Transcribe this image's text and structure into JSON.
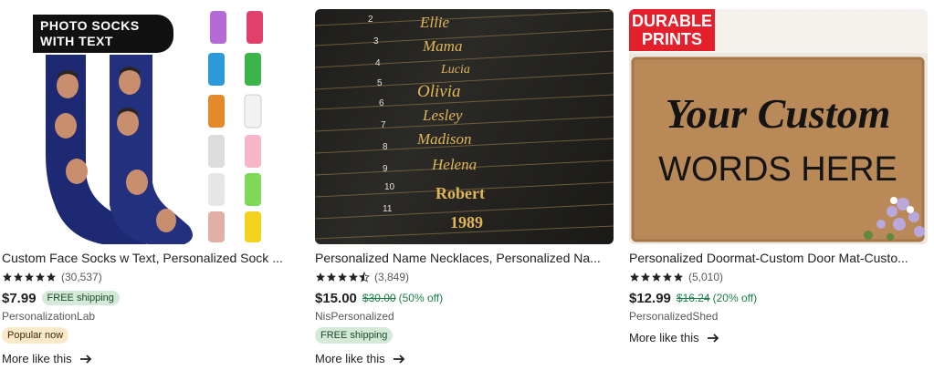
{
  "cards": [
    {
      "image_caption": "PHOTO SOCKS WITH TEXT",
      "title": "Custom Face Socks w Text, Personalized Sock ...",
      "rating_count": "(30,537)",
      "stars": 5,
      "price": "$7.99",
      "shipping_badge": "FREE shipping",
      "shop": "PersonalizationLab",
      "badge": "Popular now",
      "more_label": "More like this"
    },
    {
      "image_names": [
        "2",
        "Ellie",
        "3",
        "Mama",
        "4",
        "Lucia",
        "5",
        "Olivia",
        "6",
        "Lesley",
        "7",
        "Madison",
        "8",
        "Helena",
        "9",
        "Robert",
        "10",
        "1989",
        "11"
      ],
      "title": "Personalized Name Necklaces, Personalized Na...",
      "rating_count": "(3,849)",
      "stars": 4.5,
      "price": "$15.00",
      "original_price": "$30.00",
      "discount": "(50% off)",
      "shop": "NisPersonalized",
      "badge": "FREE shipping",
      "more_label": "More like this"
    },
    {
      "image_badge": "DURABLE PRINTS",
      "image_text_1": "Your Custom",
      "image_text_2": "WORDS HERE",
      "title": "Personalized Doormat-Custom Door Mat-Custo...",
      "rating_count": "(5,010)",
      "stars": 5,
      "price": "$12.99",
      "original_price": "$16.24",
      "discount": "(20% off)",
      "shop": "PersonalizedShed",
      "more_label": "More like this"
    }
  ],
  "colors": {
    "star": "#222222",
    "free_shipping_bg": "#d4e9d7",
    "popular_bg": "#fae8c8",
    "discount_green": "#1c7c46"
  }
}
